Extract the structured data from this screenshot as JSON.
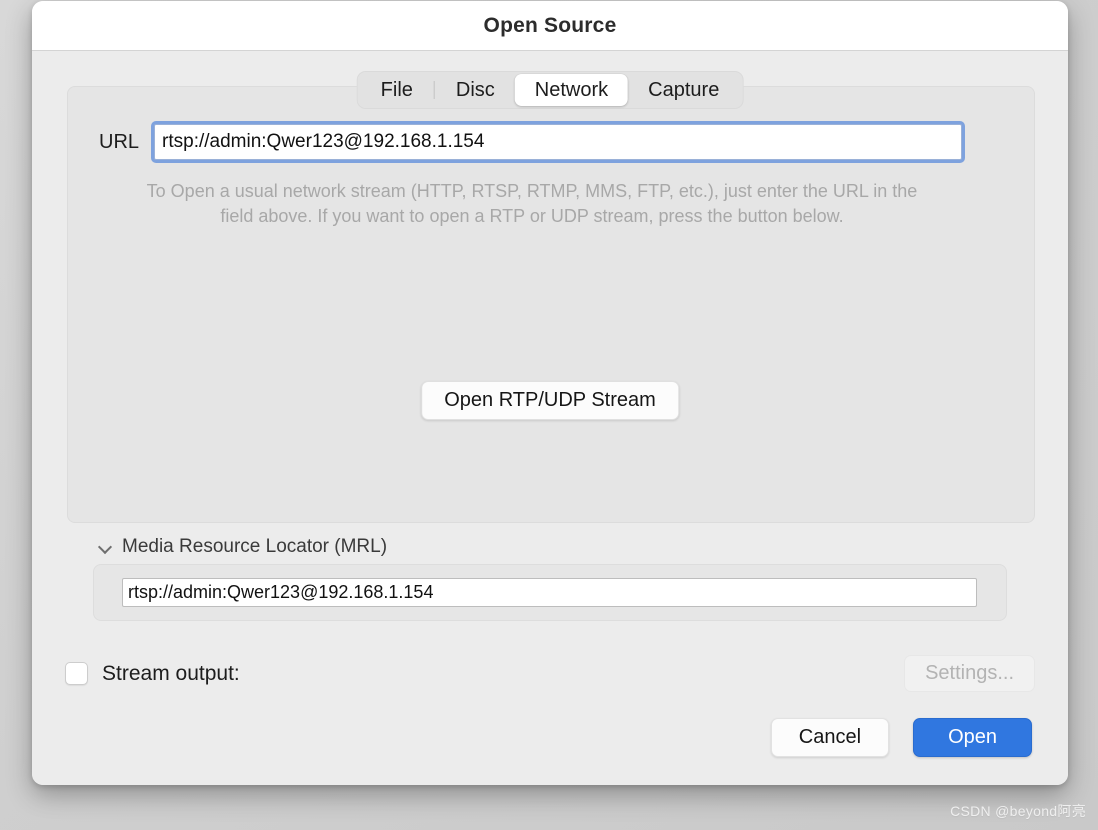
{
  "window": {
    "title": "Open Source"
  },
  "tabs": [
    {
      "label": "File",
      "selected": false
    },
    {
      "label": "Disc",
      "selected": false
    },
    {
      "label": "Network",
      "selected": true
    },
    {
      "label": "Capture",
      "selected": false
    }
  ],
  "network_tab": {
    "url_label": "URL",
    "url_value": "rtsp://admin:Qwer123@192.168.1.154",
    "url_placeholder": "",
    "hint_text": "To Open a usual network stream (HTTP, RTSP, RTMP, MMS, FTP, etc.), just enter the URL in the field above. If you want to open a RTP or UDP stream, press the button below.",
    "rtp_button_label": "Open RTP/UDP Stream"
  },
  "mrl": {
    "chevron_icon": "chevron-down-icon",
    "title": "Media Resource Locator (MRL)",
    "value": "rtsp://admin:Qwer123@192.168.1.154",
    "placeholder": ""
  },
  "stream_output": {
    "label": "Stream output:",
    "checked": false,
    "settings_label": "Settings...",
    "settings_disabled": true
  },
  "footer": {
    "cancel_label": "Cancel",
    "open_label": "Open"
  },
  "watermark": {
    "text": "CSDN @beyond阿亮"
  },
  "colors": {
    "accent": "#3077e0",
    "focus_ring": "#7ea2de",
    "dialog_bg": "#ececec",
    "panel_bg": "#e5e5e5",
    "hint_text": "#a8a8a8",
    "disabled_text": "#b3b3b3"
  }
}
